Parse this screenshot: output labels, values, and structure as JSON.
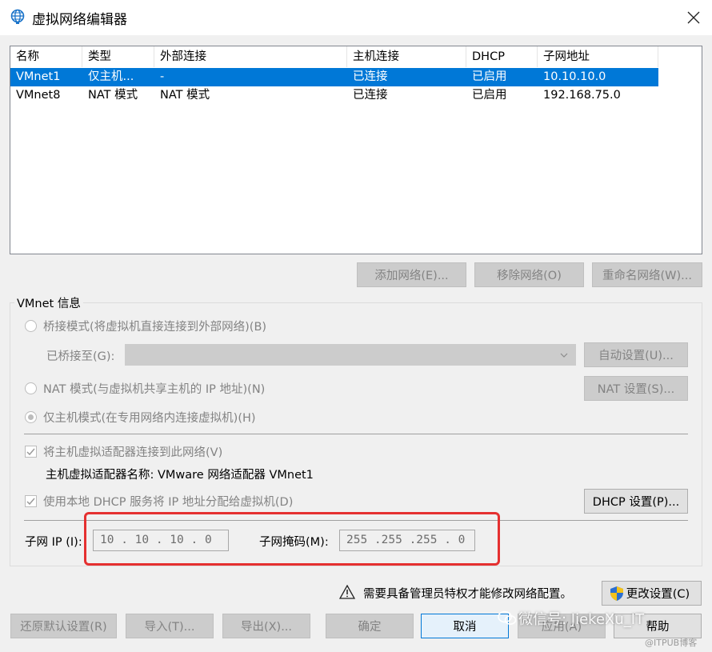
{
  "window": {
    "title": "虚拟网络编辑器"
  },
  "list": {
    "columns": [
      "名称",
      "类型",
      "外部连接",
      "主机连接",
      "DHCP",
      "子网地址"
    ],
    "rows": [
      [
        "VMnet1",
        "仅主机...",
        "-",
        "已连接",
        "已启用",
        "10.10.10.0"
      ],
      [
        "VMnet8",
        "NAT 模式",
        "NAT 模式",
        "已连接",
        "已启用",
        "192.168.75.0"
      ]
    ],
    "selected_row": 0
  },
  "list_buttons": {
    "add": "添加网络(E)...",
    "remove": "移除网络(O)",
    "rename": "重命名网络(W)..."
  },
  "vmnet_info": {
    "group_label": "VMnet 信息",
    "bridge_mode": "桥接模式(将虚拟机直接连接到外部网络)(B)",
    "bridged_to_label": "已桥接至(G):",
    "auto_settings": "自动设置(U)...",
    "nat_mode": "NAT 模式(与虚拟机共享主机的 IP 地址)(N)",
    "nat_settings": "NAT 设置(S)...",
    "host_only_mode": "仅主机模式(在专用网络内连接虚拟机)(H)",
    "connect_adapter": "将主机虚拟适配器连接到此网络(V)",
    "adapter_name": "主机虚拟适配器名称: VMware 网络适配器 VMnet1",
    "use_dhcp": "使用本地 DHCP 服务将 IP 地址分配给虚拟机(D)",
    "dhcp_settings": "DHCP 设置(P)...",
    "subnet_ip_label": "子网 IP (I):",
    "subnet_ip_value": "10 . 10 . 10 . 0",
    "subnet_mask_label": "子网掩码(M):",
    "subnet_mask_value": "255 .255 .255 . 0"
  },
  "footer": {
    "admin_warning": "需要具备管理员特权才能修改网络配置。",
    "change_settings": "更改设置(C)",
    "restore_defaults": "还原默认设置(R)",
    "import": "导入(T)...",
    "export": "导出(X)...",
    "ok": "确定",
    "cancel": "取消",
    "apply": "应用(A)",
    "help": "帮助"
  },
  "watermark": {
    "main": "微信号: JiekeXu_IT",
    "sub": "@ITPUB博客"
  },
  "colors": {
    "selection": "#0078d7",
    "highlight_border": "#e53030"
  }
}
